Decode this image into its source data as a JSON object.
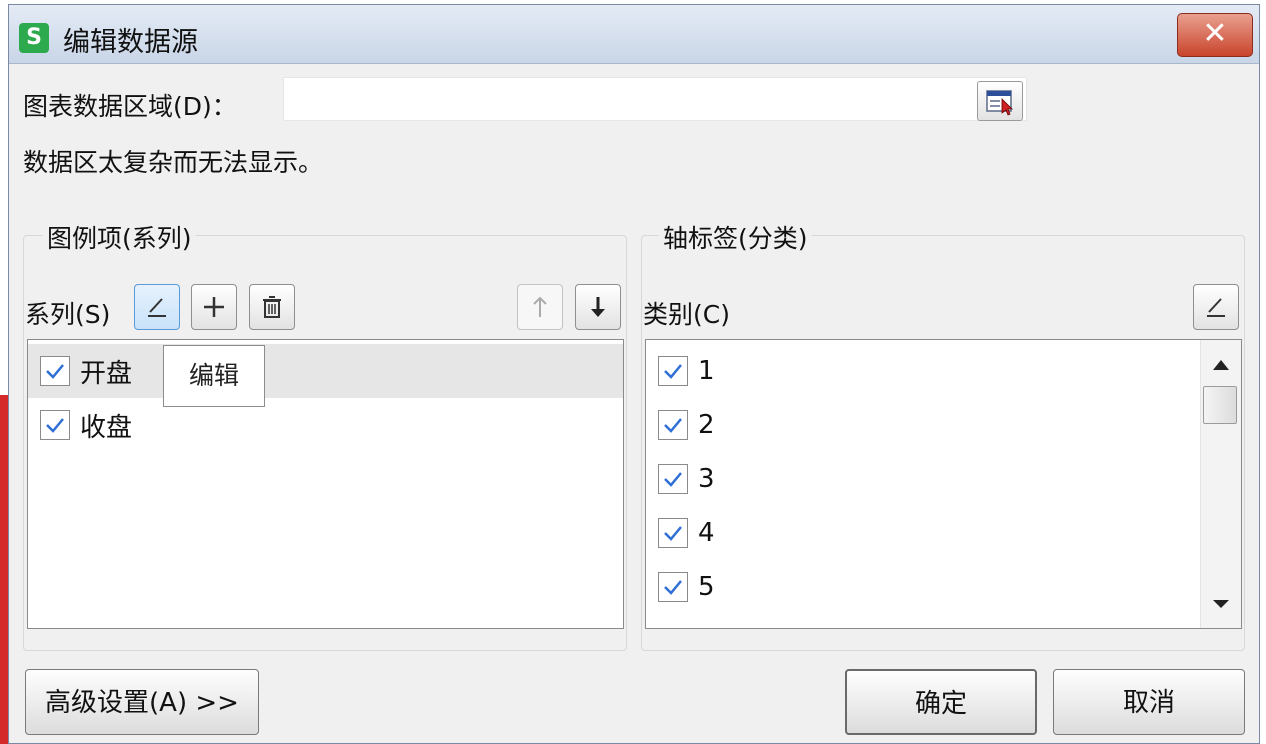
{
  "window": {
    "title": "编辑数据源",
    "app_icon_letter": "S",
    "close_glyph": "✕"
  },
  "range": {
    "label": "图表数据区域(D)：",
    "value": "",
    "message": "数据区太复杂而无法显示。"
  },
  "series_group": {
    "title": "图例项(系列)",
    "list_label": "系列(S)",
    "items": [
      {
        "label": "开盘",
        "checked": true,
        "selected": true
      },
      {
        "label": "收盘",
        "checked": true,
        "selected": false
      }
    ],
    "tooltip": "编辑"
  },
  "axis_group": {
    "title": "轴标签(分类)",
    "list_label": "类别(C)",
    "items": [
      {
        "label": "1",
        "checked": true
      },
      {
        "label": "2",
        "checked": true
      },
      {
        "label": "3",
        "checked": true
      },
      {
        "label": "4",
        "checked": true
      },
      {
        "label": "5",
        "checked": true
      }
    ]
  },
  "footer": {
    "advanced_label": "高级设置(A) >>",
    "ok_label": "确定",
    "cancel_label": "取消"
  },
  "colors": {
    "check": "#2f6fd6",
    "app_icon": "#2eaa4e",
    "close": "#c9442c"
  }
}
